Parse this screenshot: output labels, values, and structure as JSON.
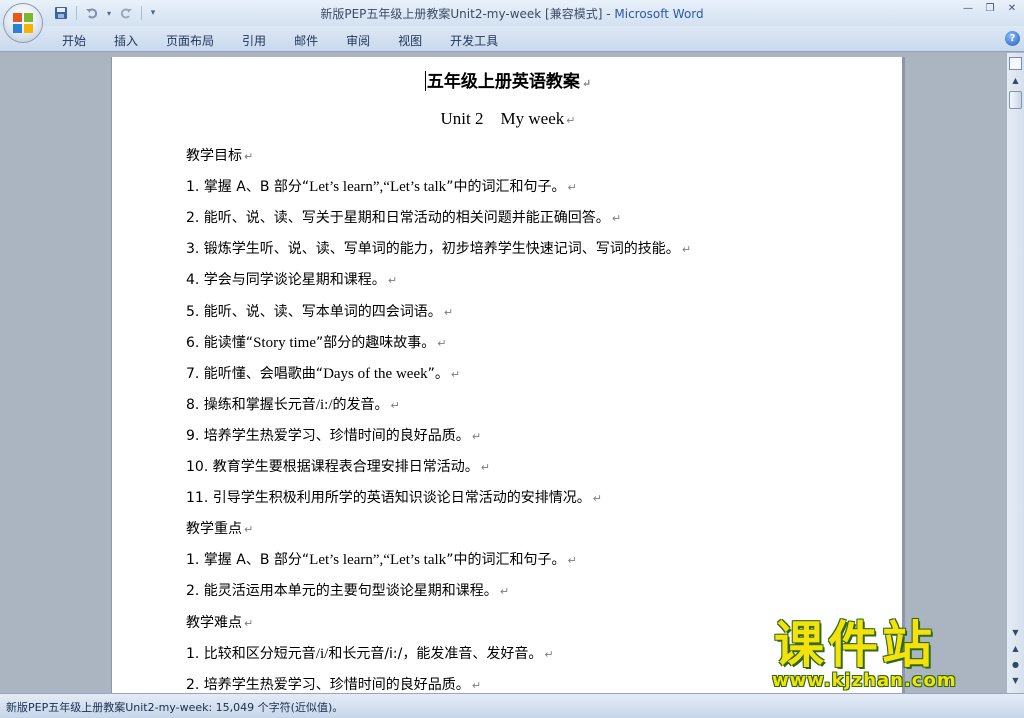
{
  "window": {
    "title": "新版PEP五年级上册教案Unit2-my-week [兼容模式] - ",
    "app_name": "Microsoft Word"
  },
  "quick_access": {
    "save_icon": "save-icon",
    "undo_icon": "undo-icon",
    "redo_icon": "redo-icon",
    "customize_icon": "dropdown-icon"
  },
  "ribbon": {
    "tabs": [
      "开始",
      "插入",
      "页面布局",
      "引用",
      "邮件",
      "审阅",
      "视图",
      "开发工具"
    ],
    "help_icon": "help-icon",
    "help_glyph": "?"
  },
  "document": {
    "title": "五年级上册英语教案",
    "subtitle": "Unit 2    My week",
    "paragraph_mark": "↵",
    "lines": [
      {
        "pre": "教学目标",
        "en": "",
        "post": ""
      },
      {
        "pre": "1. 掌握 A、B 部分“",
        "en": "Let’s learn”,“Let’s talk",
        "post": "”中的词汇和句子。"
      },
      {
        "pre": "2. 能听、说、读、写关于星期和日常活动的相关问题并能正确回答。",
        "en": "",
        "post": ""
      },
      {
        "pre": "3. 锻炼学生听、说、读、写单词的能力，初步培养学生快速记词、写词的技能。",
        "en": "",
        "post": ""
      },
      {
        "pre": "4. 学会与同学谈论星期和课程。",
        "en": "",
        "post": ""
      },
      {
        "pre": "5. 能听、说、读、写本单词的四会词语。",
        "en": "",
        "post": ""
      },
      {
        "pre": "6. 能读懂“",
        "en": "Story time",
        "post": "”部分的趣味故事。"
      },
      {
        "pre": "7. 能听懂、会唱歌曲“",
        "en": "Days of the week",
        "post": "”。"
      },
      {
        "pre": "8. 操练和掌握长元音",
        "en": "/i:/",
        "post": "的发音。"
      },
      {
        "pre": "9. 培养学生热爱学习、珍惜时间的良好品质。",
        "en": "",
        "post": ""
      },
      {
        "pre": "10. 教育学生要根据课程表合理安排日常活动。",
        "en": "",
        "post": ""
      },
      {
        "pre": "11. 引导学生积极利用所学的英语知识谈论日常活动的安排情况。",
        "en": "",
        "post": ""
      },
      {
        "pre": "教学重点",
        "en": "",
        "post": ""
      },
      {
        "pre": "1. 掌握 A、B 部分“",
        "en": "Let’s learn”,“Let’s talk",
        "post": "”中的词汇和句子。"
      },
      {
        "pre": "2. 能灵活运用本单元的主要句型谈论星期和课程。",
        "en": "",
        "post": ""
      },
      {
        "pre": "教学难点",
        "en": "",
        "post": ""
      },
      {
        "pre": "1. 比较和区分短元音",
        "en": "/i/",
        "post": "和长元音/i:/，能发准音、发好音。"
      },
      {
        "pre": "2. 培养学生热爱学习、珍惜时间的良好品质。",
        "en": "",
        "post": ""
      }
    ]
  },
  "status_bar": {
    "text": "新版PEP五年级上册教案Unit2-my-week: 15,049 个字符(近似值)。"
  },
  "watermark": {
    "logo_text": "课件站",
    "url": "www.kjzhan.com"
  }
}
